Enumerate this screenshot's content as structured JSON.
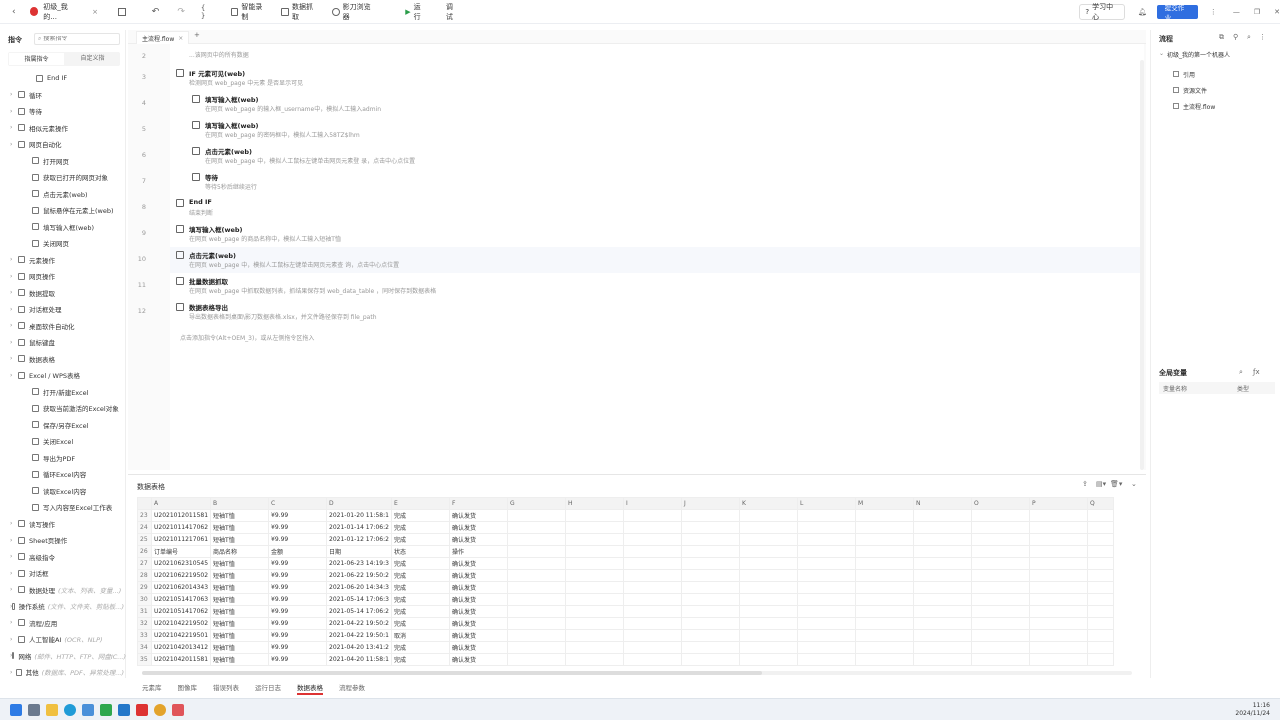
{
  "app": {
    "tab_title": "初级_我的...",
    "record_label": "智能录制",
    "grab_label": "数据抓取",
    "browser_label": "影刀浏览器",
    "run_label": "运行",
    "debug_label": "调试",
    "learn_label": "学习中心",
    "submit_label": "提交作业"
  },
  "left": {
    "header": "指令",
    "search_placeholder": "搜索指令",
    "tabs": [
      "指属指令",
      "自定义指"
    ],
    "items": [
      {
        "label": "End IF",
        "level": 2
      },
      {
        "label": "循环",
        "level": 0
      },
      {
        "label": "等待",
        "level": 0
      },
      {
        "label": "相似元素操作",
        "level": 0
      },
      {
        "label": "网页自动化",
        "level": 0
      },
      {
        "label": "打开网页",
        "level": 1
      },
      {
        "label": "获取已打开的网页对象",
        "level": 1
      },
      {
        "label": "点击元素(web)",
        "level": 1
      },
      {
        "label": "鼠标悬停在元素上(web)",
        "level": 1
      },
      {
        "label": "填写输入框(web)",
        "level": 1
      },
      {
        "label": "关闭网页",
        "level": 1
      },
      {
        "label": "元素操作",
        "level": 0
      },
      {
        "label": "网页操作",
        "level": 0
      },
      {
        "label": "数据提取",
        "level": 0
      },
      {
        "label": "对话框处理",
        "level": 0
      },
      {
        "label": "桌面软件自动化",
        "level": 0
      },
      {
        "label": "鼠标键盘",
        "level": 0
      },
      {
        "label": "数据表格",
        "level": 0
      },
      {
        "label": "Excel / WPS表格",
        "level": 0
      },
      {
        "label": "打开/新建Excel",
        "level": 1
      },
      {
        "label": "获取当前激活的Excel对象",
        "level": 1
      },
      {
        "label": "保存/另存Excel",
        "level": 1
      },
      {
        "label": "关闭Excel",
        "level": 1
      },
      {
        "label": "导出为PDF",
        "level": 1
      },
      {
        "label": "循环Excel内容",
        "level": 1
      },
      {
        "label": "读取Excel内容",
        "level": 1
      },
      {
        "label": "写入内容至Excel工作表",
        "level": 1
      },
      {
        "label": "读写操作",
        "level": 0
      },
      {
        "label": "Sheet页操作",
        "level": 0
      },
      {
        "label": "高级指令",
        "level": 0
      },
      {
        "label": "对话框",
        "level": 0
      },
      {
        "label": "数据处理",
        "level": 0,
        "hint": "(文本、列表、变量...)"
      },
      {
        "label": "操作系统",
        "level": 0,
        "hint": "(文件、文件夹、剪贴板...)"
      },
      {
        "label": "流程/应用",
        "level": 0
      },
      {
        "label": "人工智能AI",
        "level": 0,
        "hint": "(OCR、NLP)"
      },
      {
        "label": "网络",
        "level": 0,
        "hint": "(邮件、HTTP、FTP、网盘IC...)"
      },
      {
        "label": "其他",
        "level": 0,
        "hint": "(数据库、PDF、异常处理...)"
      }
    ]
  },
  "editor": {
    "tab": "主流程.flow",
    "hint": "点击添加指令(Alt+OEM_3)，或从左侧拖令区拖入",
    "rows": [
      {
        "n": "2",
        "title": "",
        "desc": "...该网页中的所有数据"
      },
      {
        "n": "3",
        "title": "IF 元素可见(web)",
        "desc": "检测网页 web_page 中元素 是否显示可见"
      },
      {
        "n": "4",
        "title": "填写输入框(web)",
        "desc": "在网页 web_page 的输入框_username中，模拟人工输入admin"
      },
      {
        "n": "5",
        "title": "填写输入框(web)",
        "desc": "在网页 web_page 的密码框中，模拟人工输入58TZ$lhm"
      },
      {
        "n": "6",
        "title": "点击元素(web)",
        "desc": "在网页 web_page 中，模拟人工鼠标左键单击网页元素登 录，点击中心点位置"
      },
      {
        "n": "7",
        "title": "等待",
        "desc": "等待5秒后继续运行"
      },
      {
        "n": "8",
        "title": "End IF",
        "desc": "结束判断"
      },
      {
        "n": "9",
        "title": "填写输入框(web)",
        "desc": "在网页 web_page 的商品名称中，模拟人工输入短袖T恤"
      },
      {
        "n": "10",
        "title": "点击元素(web)",
        "desc": "在网页 web_page 中，模拟人工鼠标左键单击网页元素查 询，点击中心点位置"
      },
      {
        "n": "11",
        "title": "批量数据抓取",
        "desc": "在网页 web_page 中抓取数据列表，抓结果保存到 web_data_table ，同时保存到数据表格"
      },
      {
        "n": "12",
        "title": "数据表格导出",
        "desc": "导出数据表格到桌面\\影刀数据表格.xlsx，并文件路径保存到 file_path"
      }
    ]
  },
  "right": {
    "header": "流程",
    "robot": "初级_我的第一个机器人",
    "items": [
      "引用",
      "资源文件",
      "主流程.flow"
    ],
    "vars_header": "全局变量",
    "var_cols": [
      "变量名称",
      "类型"
    ]
  },
  "bottom": {
    "title": "数据表格",
    "columns": [
      "A",
      "B",
      "C",
      "D",
      "E",
      "F",
      "G",
      "H",
      "I",
      "J",
      "K",
      "L",
      "M",
      "N",
      "O",
      "P",
      "Q"
    ],
    "rows": [
      [
        "23",
        "U2021012011581",
        "短袖T恤",
        "¥9.99",
        "2021-01-20 11:58:1",
        "完成",
        "确认发货"
      ],
      [
        "24",
        "U2021011417062",
        "短袖T恤",
        "¥9.99",
        "2021-01-14 17:06:2",
        "完成",
        "确认发货"
      ],
      [
        "25",
        "U2021011217061",
        "短袖T恤",
        "¥9.99",
        "2021-01-12 17:06:2",
        "完成",
        "确认发货"
      ],
      [
        "26",
        "订单编号",
        "商品名称",
        "金额",
        "日期",
        "状态",
        "操作"
      ],
      [
        "27",
        "U2021062310545",
        "短袖T恤",
        "¥9.99",
        "2021-06-23 14:19:3",
        "完成",
        "确认发货"
      ],
      [
        "28",
        "U2021062219502",
        "短袖T恤",
        "¥9.99",
        "2021-06-22 19:50:2",
        "完成",
        "确认发货"
      ],
      [
        "29",
        "U2021062014343",
        "短袖T恤",
        "¥9.99",
        "2021-06-20 14:34:3",
        "完成",
        "确认发货"
      ],
      [
        "30",
        "U2021051417063",
        "短袖T恤",
        "¥9.99",
        "2021-05-14 17:06:3",
        "完成",
        "确认发货"
      ],
      [
        "31",
        "U2021051417062",
        "短袖T恤",
        "¥9.99",
        "2021-05-14 17:06:2",
        "完成",
        "确认发货"
      ],
      [
        "32",
        "U2021042219502",
        "短袖T恤",
        "¥9.99",
        "2021-04-22 19:50:2",
        "完成",
        "确认发货"
      ],
      [
        "33",
        "U2021042219501",
        "短袖T恤",
        "¥9.99",
        "2021-04-22 19:50:1",
        "取消",
        "确认发货"
      ],
      [
        "34",
        "U2021042013412",
        "短袖T恤",
        "¥9.99",
        "2021-04-20 13:41:2",
        "完成",
        "确认发货"
      ],
      [
        "35",
        "U2021042011581",
        "短袖T恤",
        "¥9.99",
        "2021-04-20 11:58:1",
        "完成",
        "确认发货"
      ]
    ],
    "tabs": [
      "元素库",
      "图像库",
      "错误列表",
      "运行日志",
      "数据表格",
      "流程参数"
    ],
    "active_tab": "数据表格"
  },
  "taskbar": {
    "time": "11:16",
    "date": "2024/11/24"
  }
}
